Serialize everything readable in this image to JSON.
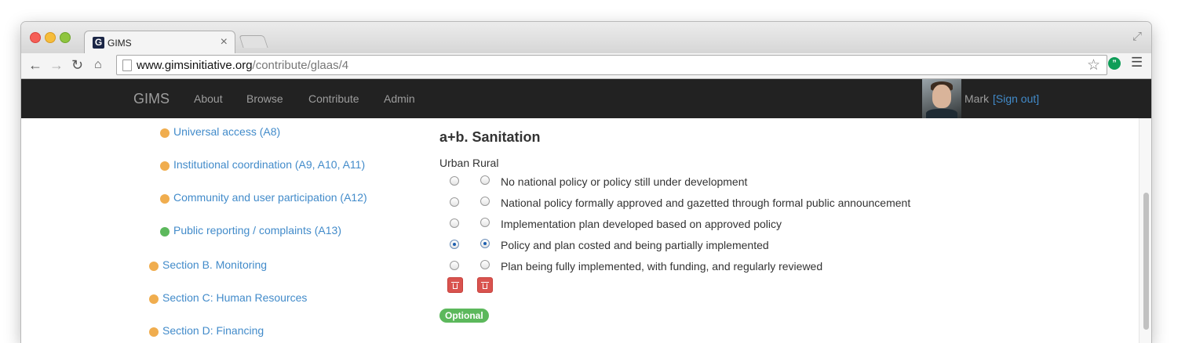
{
  "browser": {
    "tab_title": "GIMS",
    "favicon_letter": "G",
    "url_host": "www.gimsinitiative.org",
    "url_path": "/contribute/glaas/4"
  },
  "navbar": {
    "brand": "GIMS",
    "items": [
      "About",
      "Browse",
      "Contribute",
      "Admin"
    ],
    "user_name": "Mark",
    "sign_out": "[Sign out]"
  },
  "sidebar": {
    "items": [
      {
        "label": "Universal access (A8)",
        "status": "orange"
      },
      {
        "label": "Institutional coordination (A9, A10, A11)",
        "status": "orange"
      },
      {
        "label": "Community and user participation (A12)",
        "status": "orange"
      },
      {
        "label": "Public reporting / complaints (A13)",
        "status": "green"
      },
      {
        "label": "Section B. Monitoring",
        "status": "orange"
      },
      {
        "label": "Section C: Human Resources",
        "status": "orange"
      },
      {
        "label": "Section D: Financing",
        "status": "orange"
      }
    ]
  },
  "question": {
    "title": "a+b. Sanitation",
    "columns": [
      "Urban",
      "Rural"
    ],
    "options": [
      "No national policy or policy still under development",
      "National policy formally approved and gazetted through formal public announcement",
      "Implementation plan developed based on approved policy",
      "Policy and plan costed and being partially implemented",
      "Plan being fully implemented, with funding, and regularly reviewed"
    ],
    "selected_urban": 3,
    "selected_rural": 3,
    "badge": "Optional"
  },
  "colors": {
    "navbar_bg": "#222222",
    "link": "#428bca",
    "status_orange": "#f0ad4e",
    "status_green": "#5cb85c",
    "delete_button": "#d9534f"
  },
  "icons": [
    "back-icon",
    "forward-icon",
    "reload-icon",
    "home-icon",
    "page-icon",
    "star-icon",
    "hangouts-icon",
    "menu-icon",
    "trash-icon",
    "close-icon",
    "fullscreen-icon"
  ]
}
